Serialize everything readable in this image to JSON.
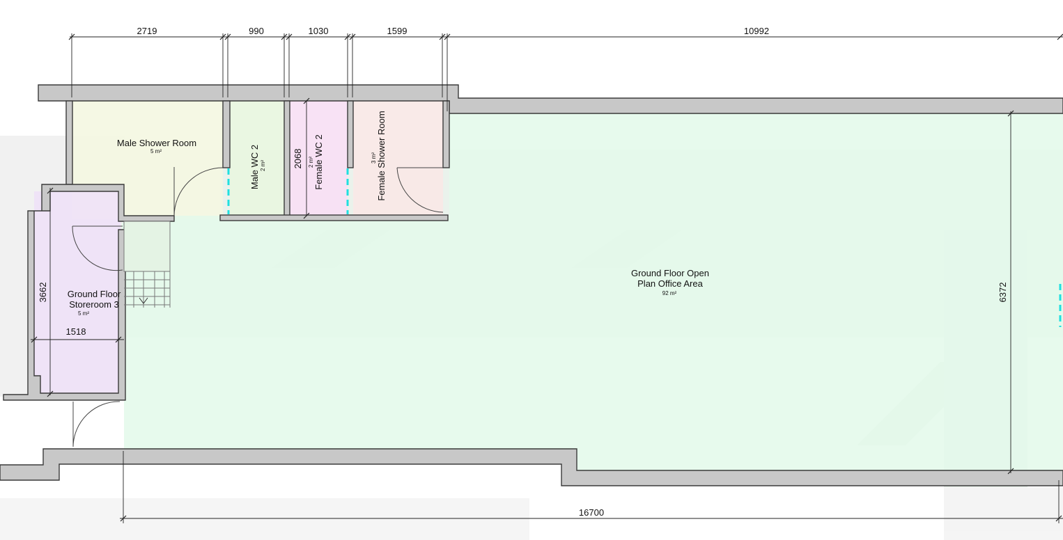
{
  "colors": {
    "male_shower": "#f4f7e2",
    "male_wc": "#e8f6df",
    "female_wc": "#f7e0f4",
    "female_shower": "#f9e8e6",
    "storeroom": "#efe2f7",
    "office": "#e4f9ea",
    "walls": "#c8c8c8",
    "glazing": "#1fe0e0",
    "ghost": "#ececec"
  },
  "rooms": {
    "male_shower": {
      "name": "Male Shower Room",
      "area": "5 m²"
    },
    "male_wc": {
      "name": "Male WC 2",
      "area": "2 m²"
    },
    "female_wc": {
      "name": "Female WC 2",
      "area": "2 m²"
    },
    "female_shower": {
      "name": "Female Shower Room",
      "area": "3 m²"
    },
    "storeroom": {
      "name_line1": "Ground Floor",
      "name_line2": "Storeroom 3",
      "area": "5 m²"
    },
    "office": {
      "name_line1": "Ground Floor Open",
      "name_line2": "Plan Office Area",
      "area": "92 m²"
    }
  },
  "dimensions": {
    "top": [
      "2719",
      "990",
      "1030",
      "1599",
      "10992"
    ],
    "female_wc_height": "2068",
    "storeroom_height": "3662",
    "storeroom_width": "1518",
    "office_height": "6372",
    "bottom_total": "16700"
  }
}
